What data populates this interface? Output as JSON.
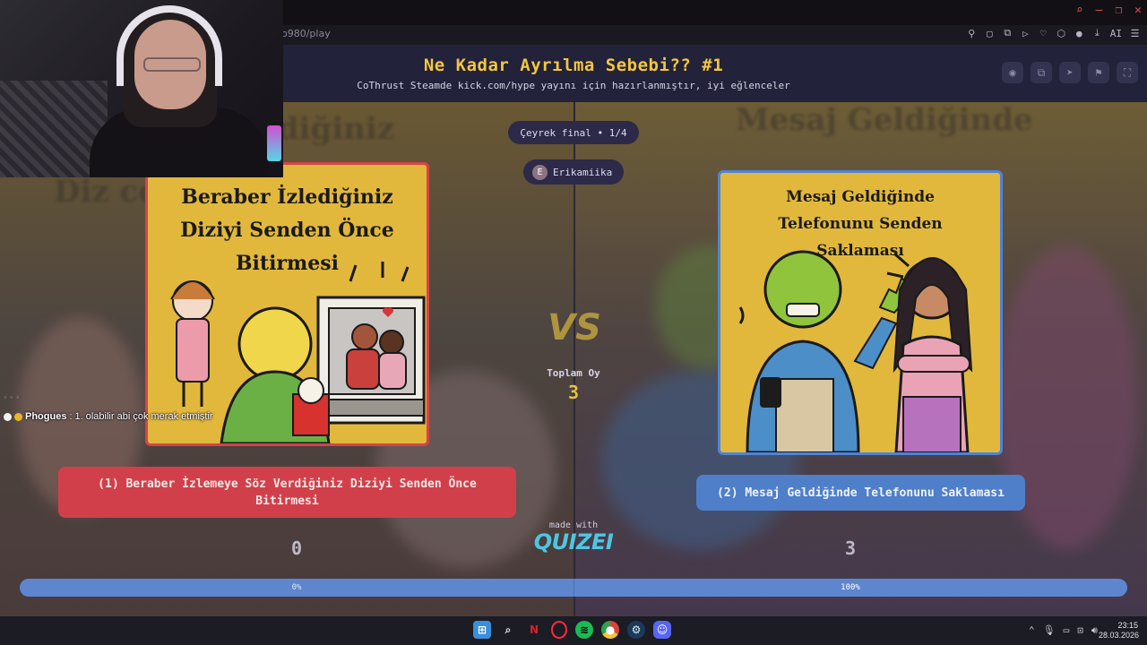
{
  "browser": {
    "url": "o980/play",
    "tools": [
      "pin-icon",
      "screenshot-icon",
      "snapshot-icon",
      "play-icon",
      "heart-icon",
      "extensions-icon",
      "profile-icon",
      "download-icon",
      "ai-icon",
      "menu-icon"
    ],
    "ai_label": "AI"
  },
  "header": {
    "title": "Ne Kadar Ayrılma Sebebi?? #1",
    "subtitle": "CoThrust Steamde kick.com/hype yayını için hazırlanmıştır, iyi eğlenceler",
    "actions": [
      "eye-icon",
      "copy-icon",
      "send-icon",
      "flag-icon",
      "fullscreen-icon"
    ]
  },
  "round": {
    "label": "Çeyrek final • 1/4"
  },
  "user": {
    "name": "Erikamiika",
    "initial": "E"
  },
  "left_option": {
    "card_title": "Beraber İzlediğiniz Diziyi Senden Önce Bitirmesi",
    "button_label": "(1) Beraber İzlemeye Söz Verdiğiniz Diziyi Senden Önce Bitirmesi",
    "votes": "0",
    "percent_label": "0%"
  },
  "right_option": {
    "card_title": "Mesaj Geldiğinde Telefonunu Senden Saklaması",
    "button_label": "(2) Mesaj Geldiğinde Telefonunu Saklaması",
    "votes": "3",
    "percent_label": "100%"
  },
  "progress": {
    "left_fraction": 0.0,
    "right_fraction": 1.0
  },
  "vs": {
    "label": "VS"
  },
  "total": {
    "label": "Toplam Oy",
    "value": "3"
  },
  "footer": {
    "made_with": "made with",
    "brand": "QUIZEI"
  },
  "chat": {
    "user": "Phogues",
    "message": "1. olabilir abi çok merak etmiştir",
    "badge_colors": [
      "#f2f2f2",
      "#e9b52a"
    ]
  },
  "taskbar": {
    "apps": [
      "windows-start-icon",
      "search-icon",
      "netflix-icon",
      "opera-icon",
      "spotify-icon",
      "chrome-icon",
      "steam-icon",
      "discord-icon"
    ],
    "time": "23:15",
    "date": "28.03.2026"
  },
  "colors": {
    "accent_yellow": "#f3c640",
    "left_red": "#d1404a",
    "right_blue": "#4f7fc9",
    "header_bg": "#22223a"
  }
}
